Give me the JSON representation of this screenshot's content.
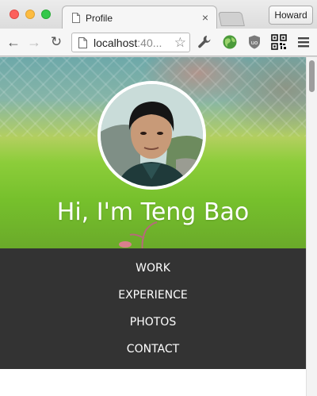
{
  "window": {
    "profile_name": "Howard"
  },
  "tab": {
    "title": "Profile",
    "close_glyph": "×"
  },
  "toolbar": {
    "back_glyph": "←",
    "forward_glyph": "→",
    "reload_glyph": "↻",
    "url_host": "localhost",
    "url_rest": ":40...",
    "star_glyph": "☆",
    "extensions": [
      "wrench-icon",
      "globe-icon",
      "ublock-icon",
      "qr-code-icon",
      "hamburger-menu-icon"
    ]
  },
  "page": {
    "hero_title": "Hi, I'm Teng Bao",
    "nav_items": [
      "WORK",
      "EXPERIENCE",
      "PHOTOS",
      "CONTACT"
    ],
    "colors": {
      "nav_background": "#333333",
      "nav_text": "#ffffff",
      "hero_green": "#8ccd3a"
    }
  }
}
